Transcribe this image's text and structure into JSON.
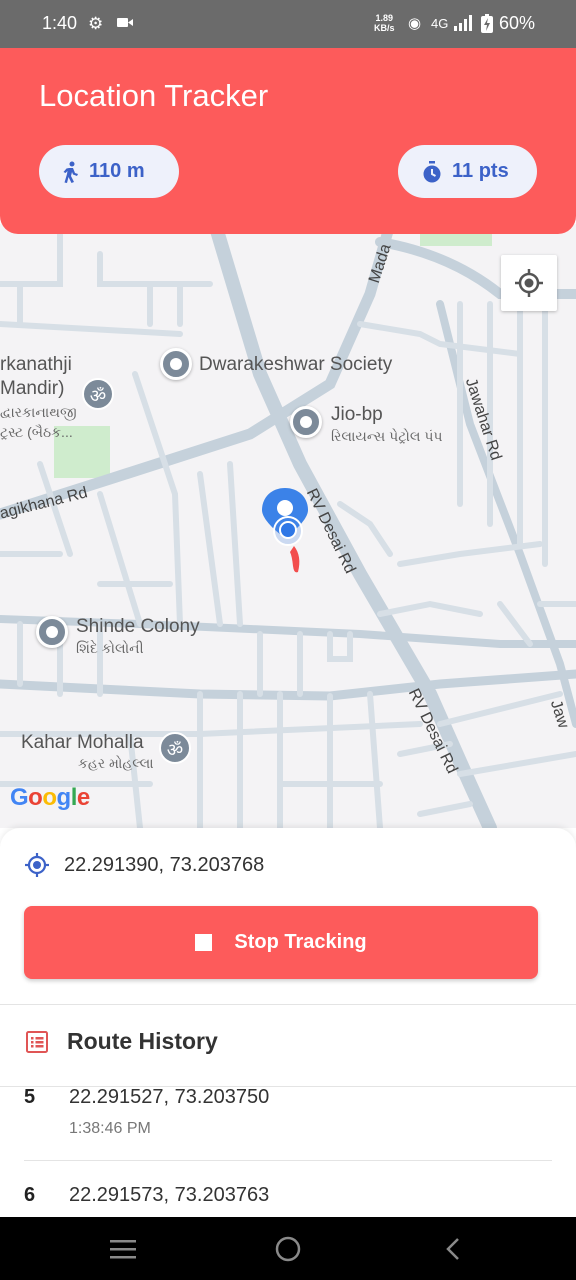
{
  "status_bar": {
    "time": "1:40",
    "speed": "1.89",
    "speed_unit": "KB/s",
    "network": "4G",
    "battery": "60%"
  },
  "header": {
    "title": "Location Tracker",
    "distance": "110 m",
    "points": "11 pts",
    "accent": "#fd5b5b",
    "chip_text_color": "#3c62c8"
  },
  "map": {
    "places": {
      "dwarakeshwar": "Dwarakeshwar Society",
      "jio_name": "Jio-bp",
      "jio_sub": "રિલાયન્સ પેટ્રોલ પંપ",
      "shinde_name": "Shinde Colony",
      "shinde_sub": "શિંદે કોલોની",
      "kahar_name": "Kahar Mohalla",
      "kahar_sub": "કહર મોહલ્લા",
      "temple_l1": "rkanathji",
      "temple_l2": "Mandir)",
      "temple_l3": "દ્વારકાનાથજી",
      "temple_l4": "ટ્રસ્ટ (બૈઠક..."
    },
    "roads": {
      "rv_desai_1": "RV Desai Rd",
      "rv_desai_2": "RV Desai Rd",
      "jawahar": "Jawahar Rd",
      "bagikhana": "agikhana Rd",
      "mada": "Mada",
      "jaw_edge": "Jaw"
    },
    "logo": "Google"
  },
  "panel": {
    "current_coords": "22.291390, 73.203768",
    "stop_label": "Stop Tracking",
    "history_title": "Route History",
    "history": [
      {
        "index": "5",
        "coords": "22.291527, 73.203750",
        "time": "1:38:46 PM"
      },
      {
        "index": "6",
        "coords": "22.291573, 73.203763",
        "time": ""
      }
    ]
  }
}
